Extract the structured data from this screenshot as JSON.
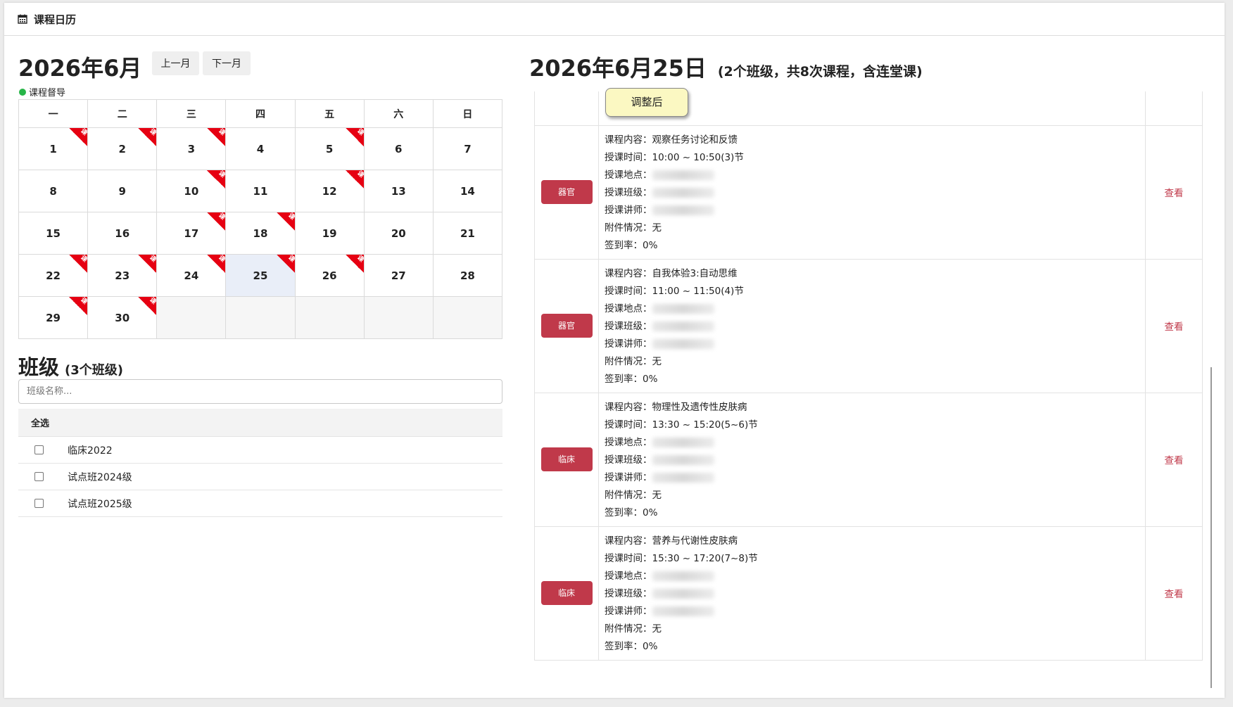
{
  "header": {
    "title": "课程日历",
    "icon": "calendar-icon"
  },
  "calendar": {
    "month_title": "2026年6月",
    "prev_label": "上一月",
    "next_label": "下一月",
    "legend_label": "课程督导",
    "legend_color": "#27b548",
    "weekdays": [
      "一",
      "二",
      "三",
      "四",
      "五",
      "六",
      "日"
    ],
    "ribbon_text": "课",
    "ribbon_color": "#e60012",
    "selected_day": 25,
    "weeks": [
      [
        {
          "d": "1",
          "r": true
        },
        {
          "d": "2",
          "r": true
        },
        {
          "d": "3",
          "r": true
        },
        {
          "d": "4",
          "r": false
        },
        {
          "d": "5",
          "r": true
        },
        {
          "d": "6",
          "r": false
        },
        {
          "d": "7",
          "r": false
        }
      ],
      [
        {
          "d": "8",
          "r": false
        },
        {
          "d": "9",
          "r": false
        },
        {
          "d": "10",
          "r": true
        },
        {
          "d": "11",
          "r": false
        },
        {
          "d": "12",
          "r": true
        },
        {
          "d": "13",
          "r": false
        },
        {
          "d": "14",
          "r": false
        }
      ],
      [
        {
          "d": "15",
          "r": false
        },
        {
          "d": "16",
          "r": false
        },
        {
          "d": "17",
          "r": true
        },
        {
          "d": "18",
          "r": true
        },
        {
          "d": "19",
          "r": false
        },
        {
          "d": "20",
          "r": false
        },
        {
          "d": "21",
          "r": false
        }
      ],
      [
        {
          "d": "22",
          "r": true
        },
        {
          "d": "23",
          "r": true
        },
        {
          "d": "24",
          "r": true
        },
        {
          "d": "25",
          "r": true
        },
        {
          "d": "26",
          "r": true
        },
        {
          "d": "27",
          "r": false
        },
        {
          "d": "28",
          "r": false
        }
      ],
      [
        {
          "d": "29",
          "r": true
        },
        {
          "d": "30",
          "r": true
        },
        {
          "d": "",
          "r": false
        },
        {
          "d": "",
          "r": false
        },
        {
          "d": "",
          "r": false
        },
        {
          "d": "",
          "r": false
        },
        {
          "d": "",
          "r": false
        }
      ]
    ]
  },
  "classes": {
    "title": "班级",
    "count_label": "(3个班级)",
    "search_placeholder": "班级名称...",
    "select_all_label": "全选",
    "items": [
      "临床2022",
      "试点班2024级",
      "试点班2025级"
    ]
  },
  "day_detail": {
    "title": "2026年6月25日",
    "summary": "(2个班级，共8次课程，含连堂课)",
    "tooltip": "调整后",
    "view_label": "查看",
    "tag_color": "#c0394a",
    "field_labels": {
      "content": "课程内容：",
      "time": "授课时间：",
      "location": "授课地点：",
      "class": "授课班级：",
      "teacher": "授课讲师：",
      "attachment": "附件情况：",
      "attendance": "签到率："
    },
    "courses": [
      {
        "tag": "器官",
        "content": "观察任务讨论和反馈",
        "time": "10:00 ~ 10:50(3)节",
        "attachment": "无",
        "attendance": "0%"
      },
      {
        "tag": "器官",
        "content": "自我体验3:自动思维",
        "time": "11:00 ~ 11:50(4)节",
        "attachment": "无",
        "attendance": "0%"
      },
      {
        "tag": "临床",
        "content": "物理性及遗传性皮肤病",
        "time": "13:30 ~ 15:20(5~6)节",
        "attachment": "无",
        "attendance": "0%"
      },
      {
        "tag": "临床",
        "content": "营养与代谢性皮肤病",
        "time": "15:30 ~ 17:20(7~8)节",
        "attachment": "无",
        "attendance": "0%"
      }
    ]
  }
}
